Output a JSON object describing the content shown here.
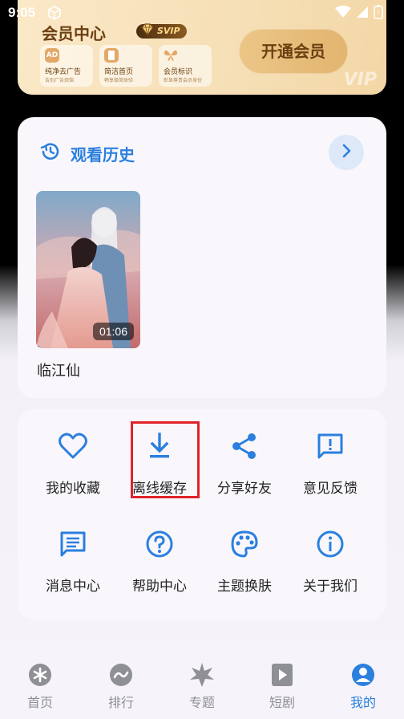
{
  "status_bar": {
    "time": "9:05"
  },
  "vip": {
    "title": "会员中心",
    "badge": "SVIP",
    "benefits": [
      {
        "icon": "AD",
        "title": "纯净去广告",
        "sub": "告别广告烦恼"
      },
      {
        "icon": "",
        "title": "简洁首页",
        "sub": "畅享极简体验"
      },
      {
        "icon": "",
        "title": "会员标识",
        "sub": "彰显尊贵会员身份"
      }
    ],
    "open_button": "开通会员",
    "watermark": "VIP"
  },
  "history": {
    "title": "观看历史",
    "items": [
      {
        "title": "临江仙",
        "duration": "01:06",
        "progress": 0.03
      }
    ]
  },
  "menu": {
    "items": [
      {
        "label": "我的收藏",
        "icon": "heart-icon"
      },
      {
        "label": "离线缓存",
        "icon": "download-icon"
      },
      {
        "label": "分享好友",
        "icon": "share-icon"
      },
      {
        "label": "意见反馈",
        "icon": "feedback-icon"
      },
      {
        "label": "消息中心",
        "icon": "message-icon"
      },
      {
        "label": "帮助中心",
        "icon": "help-icon"
      },
      {
        "label": "主题换肤",
        "icon": "palette-icon"
      },
      {
        "label": "关于我们",
        "icon": "info-icon"
      }
    ]
  },
  "nav": {
    "items": [
      {
        "label": "首页",
        "icon": "home-icon"
      },
      {
        "label": "排行",
        "icon": "ranking-icon"
      },
      {
        "label": "专题",
        "icon": "topic-icon"
      },
      {
        "label": "短剧",
        "icon": "short-drama-icon"
      },
      {
        "label": "我的",
        "icon": "profile-icon"
      }
    ],
    "active": 4
  },
  "colors": {
    "accent": "#2b7fde",
    "highlight": "#e0242a",
    "vip_text": "#6b3f10"
  }
}
